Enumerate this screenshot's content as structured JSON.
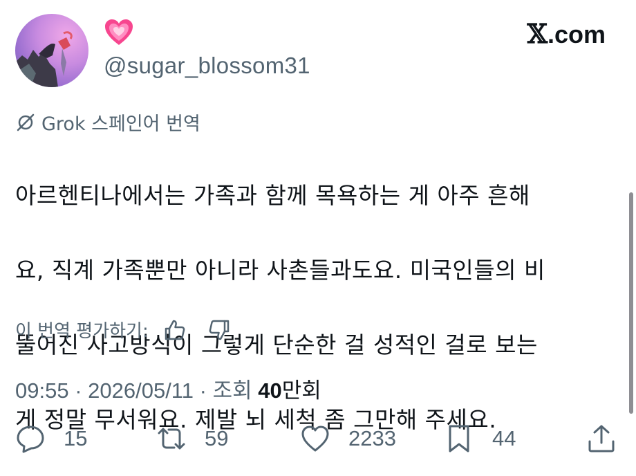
{
  "brand": {
    "logo_letter": "𝕏",
    "domain": ".com"
  },
  "author": {
    "emoji": "💗",
    "handle": "@sugar_blossom31"
  },
  "translation": {
    "label": "Grok 스페인어 번역"
  },
  "tweet": {
    "text_lines": [
      "아르헨티나에서는 가족과 함께 목욕하는 게 아주 흔해",
      "요, 직계 가족뿐만 아니라 사촌들과도요. 미국인들의 비",
      "뚤어진 사고방식이 그렇게 단순한 걸 성적인 걸로 보는",
      "게 정말 무서워요. 제발 뇌 세척 좀 그만해 주세요."
    ]
  },
  "rating": {
    "label": "이 번역 평가하기:"
  },
  "meta": {
    "time": "09:55",
    "sep1": " · ",
    "date": "2026/05/11",
    "sep2": " · ",
    "views_label": "조회 ",
    "views_num": "40",
    "views_unit": "만회"
  },
  "actions": {
    "replies": "15",
    "reposts": "59",
    "likes": "2233",
    "bookmarks": "44"
  },
  "colors": {
    "text": "#0f1419",
    "muted": "#536471",
    "heart": "#f7468f"
  }
}
